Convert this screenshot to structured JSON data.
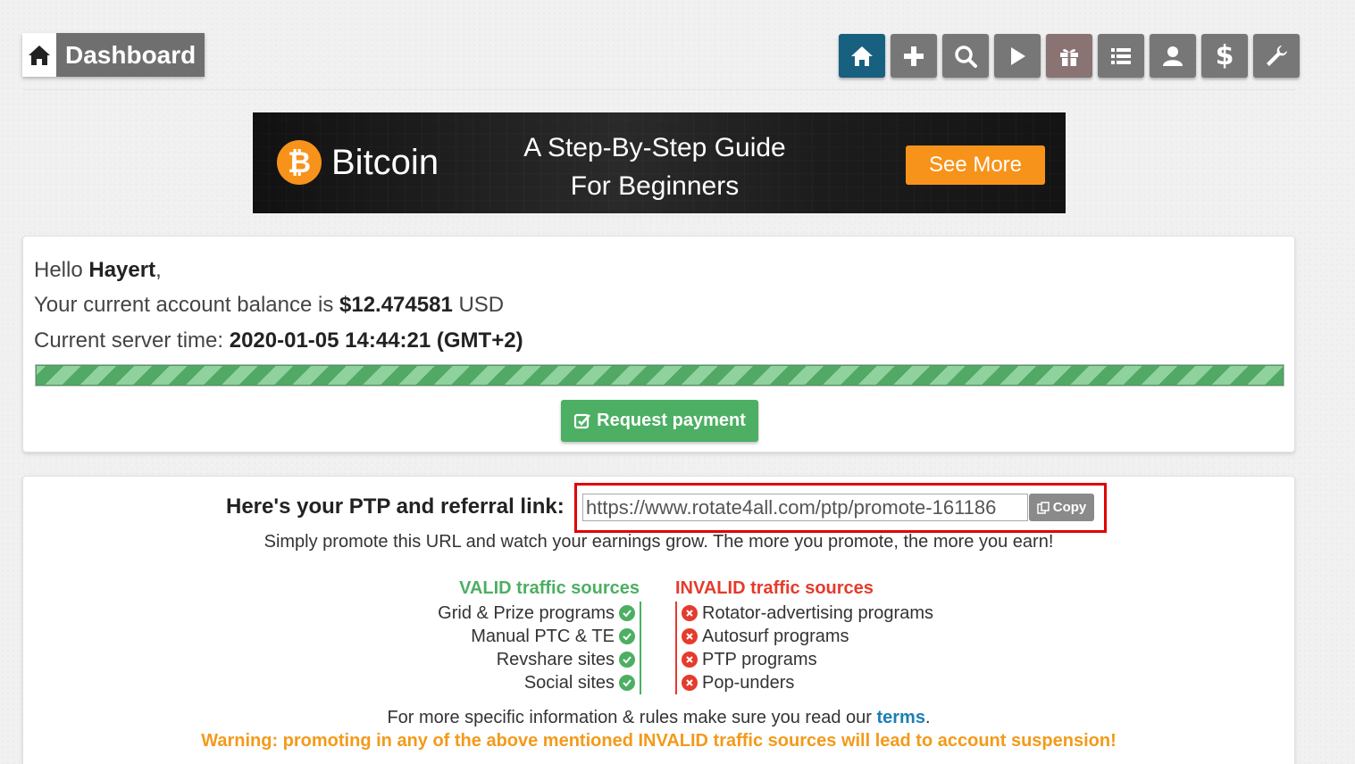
{
  "header": {
    "title": "Dashboard",
    "title_icon": "home-icon",
    "nav": [
      {
        "icon": "home-icon",
        "active": true
      },
      {
        "icon": "plus-icon",
        "active": false
      },
      {
        "icon": "search-icon",
        "active": false
      },
      {
        "icon": "play-icon",
        "active": false
      },
      {
        "icon": "gift-icon",
        "active": false
      },
      {
        "icon": "list-icon",
        "active": false
      },
      {
        "icon": "user-icon",
        "active": false
      },
      {
        "icon": "dollar-icon",
        "active": false,
        "glyph": "$"
      },
      {
        "icon": "wrench-icon",
        "active": false
      }
    ]
  },
  "banner": {
    "logo_symbol": "₿",
    "brand": "Bitcoin",
    "headline_1": "A Step-By-Step Guide",
    "headline_2": "For Beginners",
    "cta": "See More"
  },
  "account": {
    "greeting_prefix": "Hello ",
    "username": "Hayert",
    "greeting_suffix": ",",
    "balance_prefix": "Your current account balance is ",
    "balance": "$12.474581",
    "balance_suffix": " USD",
    "time_prefix": "Current server time: ",
    "server_time": "2020-01-05 14:44:21 (GMT+2)",
    "progress": 1.0,
    "request_button": "Request payment"
  },
  "referral": {
    "label": "Here's your PTP and referral link:",
    "url": "https://www.rotate4all.com/ptp/promote-161186",
    "copy_button": "Copy",
    "promote_text": "Simply promote this URL and watch your earnings grow. The more you promote, the more you earn!",
    "valid_title": "VALID traffic sources",
    "valid": [
      "Grid & Prize programs",
      "Manual PTC & TE",
      "Revshare sites",
      "Social sites"
    ],
    "invalid_title": "INVALID traffic sources",
    "invalid": [
      "Rotator-advertising programs",
      "Autosurf programs",
      "PTP programs",
      "Pop-unders"
    ],
    "rules_prefix": "For more specific information & rules make sure you read our ",
    "rules_link": "terms",
    "rules_suffix": ".",
    "warning": "Warning: promoting in any of the above mentioned INVALID traffic sources will lead to account suspension!"
  },
  "colors": {
    "nav_active": "#17607f",
    "nav_default": "#777777",
    "valid_green": "#4caf63",
    "invalid_red": "#e53b2c",
    "warning_orange": "#f39a1a",
    "link_blue": "#1b7fb5",
    "highlight_red": "#e00000",
    "bitcoin_orange": "#f7931a"
  }
}
